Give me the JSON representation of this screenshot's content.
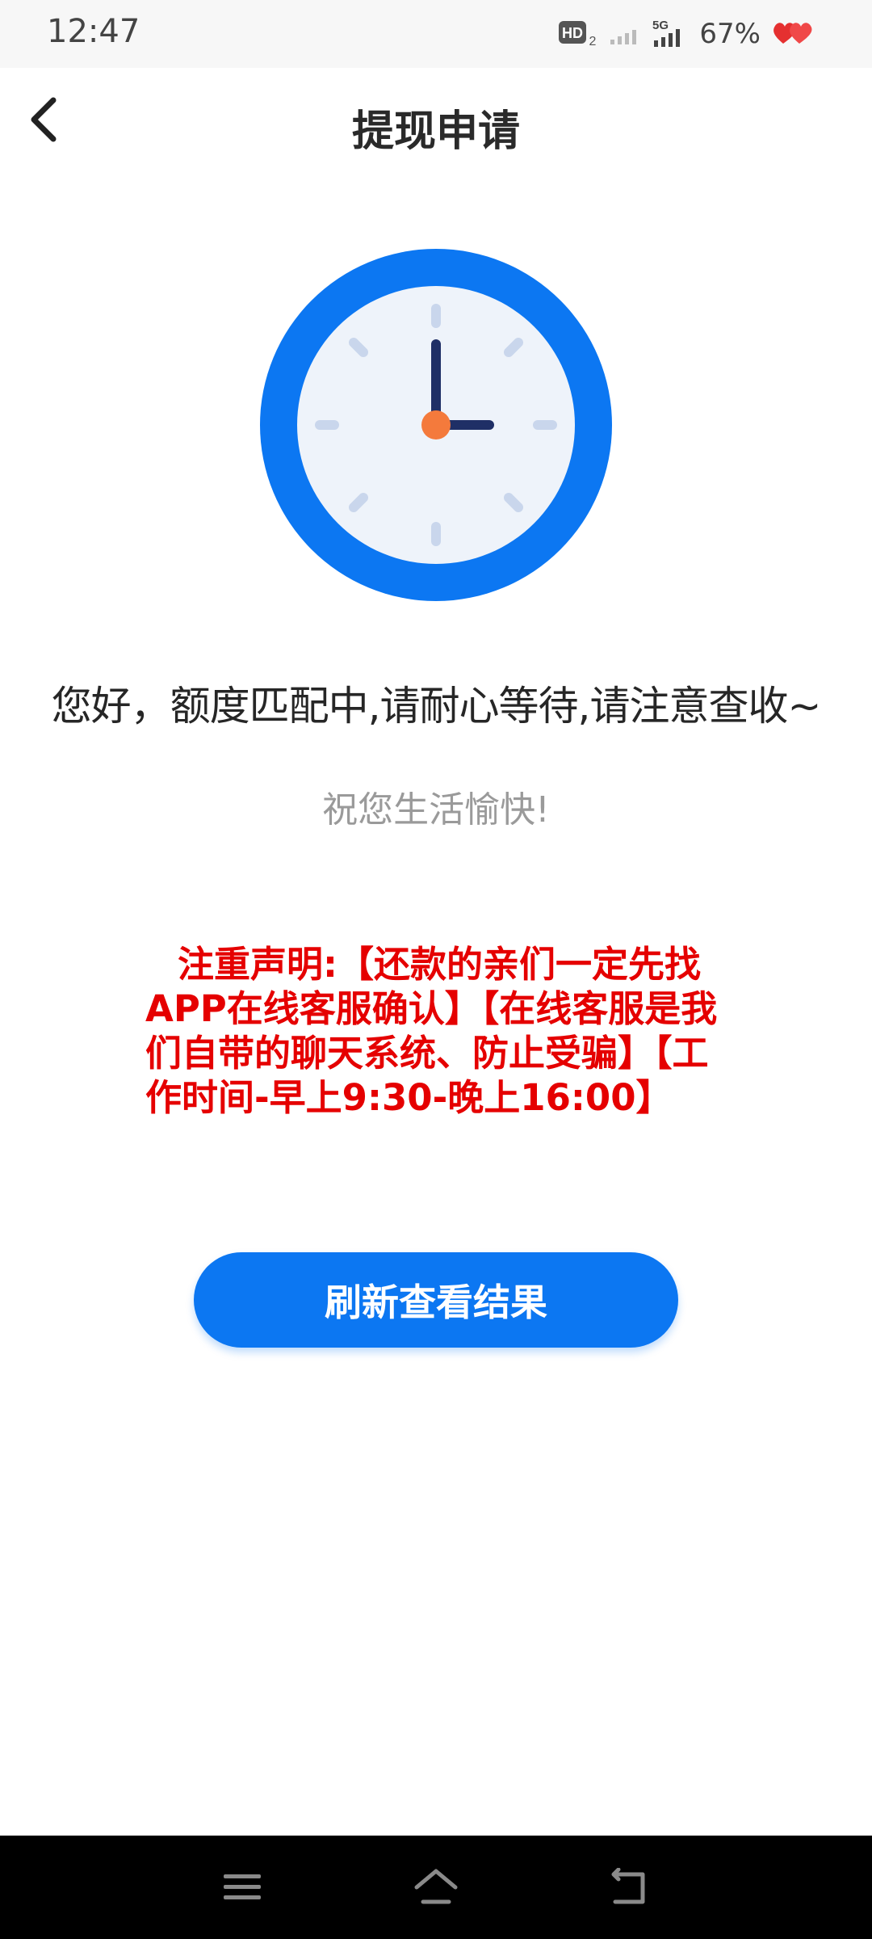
{
  "status_bar": {
    "time": "12:47",
    "hd_label": "HD",
    "hd_sub": "2",
    "network": "5G",
    "battery": "67%"
  },
  "header": {
    "title": "提现申请"
  },
  "content": {
    "message": "您好，额度匹配中,请耐心等待,请注意查收~",
    "sub_message": "祝您生活愉快!",
    "notice": "注重声明:【还款的亲们一定先找APP在线客服确认】【在线客服是我们自带的聊天系统、防止受骗】【工作时间-早上9:30-晚上16:00】",
    "refresh_button": "刷新查看结果"
  },
  "colors": {
    "accent": "#0c77f2",
    "notice": "#e50000",
    "clock_ring": "#0c77f2",
    "clock_face": "#eef3fa",
    "clock_hands": "#1f2f66",
    "clock_center": "#f47a3c"
  },
  "icons": {
    "back": "chevron-left-icon",
    "clock": "clock-icon",
    "nav_menu": "menu-icon",
    "nav_home": "home-icon",
    "nav_back": "return-icon"
  }
}
